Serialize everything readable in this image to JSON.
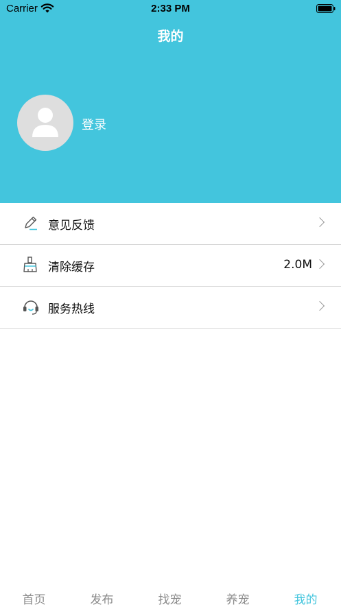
{
  "status_bar": {
    "carrier": "Carrier",
    "time": "2:33 PM"
  },
  "header": {
    "title": "我的",
    "background_color": "#43c5dd",
    "avatar_icon": "user-silhouette-icon",
    "login_label": "登录"
  },
  "menu": {
    "items": [
      {
        "label": "意见反馈",
        "icon": "pencil-icon",
        "value": ""
      },
      {
        "label": "清除缓存",
        "icon": "broom-icon",
        "value": "2.0M"
      },
      {
        "label": "服务热线",
        "icon": "headset-icon",
        "value": ""
      }
    ]
  },
  "tabbar": {
    "tabs": [
      {
        "label": "首页"
      },
      {
        "label": "发布"
      },
      {
        "label": "找宠"
      },
      {
        "label": "养宠"
      },
      {
        "label": "我的"
      }
    ],
    "active": "我的",
    "active_color": "#43c5dd",
    "inactive_color": "#8a8a8a"
  }
}
